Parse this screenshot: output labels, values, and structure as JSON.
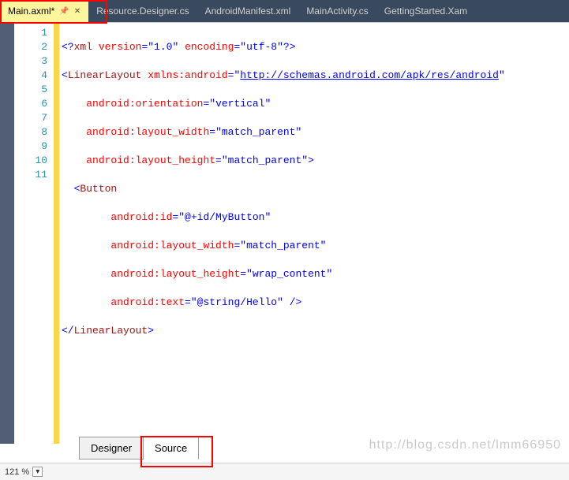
{
  "tabs": {
    "active": "Main.axml*",
    "others": [
      "Resource.Designer.cs",
      "AndroidManifest.xml",
      "MainActivity.cs",
      "GettingStarted.Xam"
    ]
  },
  "bottom_tabs": {
    "designer": "Designer",
    "source": "Source"
  },
  "status": {
    "zoom": "121 %"
  },
  "watermark": "http://blog.csdn.net/lmm66950",
  "code": {
    "l1": {
      "a": "<?",
      "b": "xml",
      "c": " version",
      "d": "=",
      "e": "\"1.0\"",
      "f": " encoding",
      "g": "=",
      "h": "\"utf-8\"",
      "i": "?>"
    },
    "l2": {
      "a": "<",
      "b": "LinearLayout",
      "c": " xmlns:android",
      "d": "=",
      "e": "\"",
      "url": "http://schemas.android.com/apk/res/android",
      "f": "\""
    },
    "l3": {
      "a": "android:orientation",
      "b": "=",
      "c": "\"vertical\""
    },
    "l4": {
      "a": "android:layout_width",
      "b": "=",
      "c": "\"match_parent\""
    },
    "l5": {
      "a": "android:layout_height",
      "b": "=",
      "c": "\"match_parent\"",
      "d": ">"
    },
    "l6": {
      "a": "<",
      "b": "Button"
    },
    "l7": {
      "a": "android:id",
      "b": "=",
      "c": "\"@+id/MyButton\""
    },
    "l8": {
      "a": "android:layout_width",
      "b": "=",
      "c": "\"match_parent\""
    },
    "l9": {
      "a": "android:layout_height",
      "b": "=",
      "c": "\"wrap_content\""
    },
    "l10": {
      "a": "android:text",
      "b": "=",
      "c": "\"@string/Hello\"",
      "d": " />"
    },
    "l11": {
      "a": "</",
      "b": "LinearLayout",
      "c": ">"
    }
  },
  "line_numbers": [
    "1",
    "2",
    "3",
    "4",
    "5",
    "6",
    "7",
    "8",
    "9",
    "10",
    "11"
  ]
}
